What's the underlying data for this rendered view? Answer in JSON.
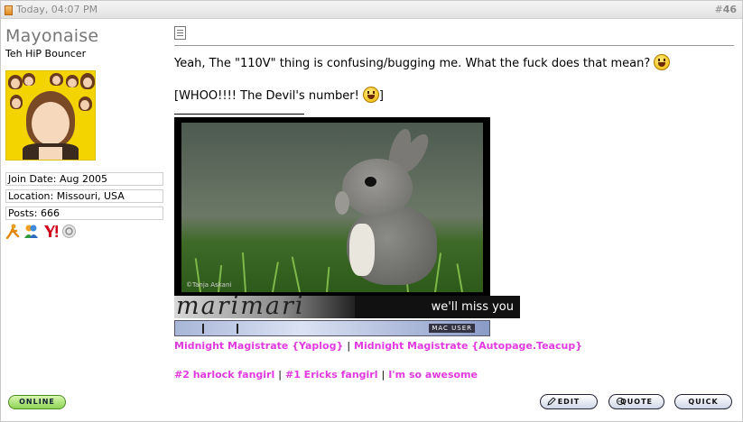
{
  "header": {
    "date": "Today, 04:07 PM",
    "post_hash": "#",
    "post_number": "46"
  },
  "user": {
    "name": "Mayonaise",
    "title": "Teh HiP Bouncer",
    "join_date": "Join Date: Aug 2005",
    "location": "Location: Missouri, USA",
    "posts": "Posts: 666",
    "im_icons": [
      "aim-icon",
      "msn-icon",
      "yahoo-icon",
      "skype-icon"
    ]
  },
  "message": {
    "line1": "Yeah, The \"110V\" thing is confusing/bugging me. What the fuck does that mean?",
    "line2_open": "[WHOO!!!! The Devil's number!",
    "line2_close": "]"
  },
  "signature": {
    "photo_credit": "©Tanja Askani",
    "script_text": "marimari",
    "miss_text": "we'll miss you",
    "mac_label": "MAC USER",
    "links": [
      "Midnight Magistrate {Yaplog}",
      "Midnight Magistrate {Autopage.Teacup}"
    ],
    "links2": [
      "#2 harlock fangirl",
      "#1 Ericks fangirl",
      "I'm so awesome"
    ],
    "link_color": "#e03adf"
  },
  "buttons": {
    "online": "ONLINE",
    "edit": "EDIT",
    "quote": "QUOTE",
    "quick": "QUICK"
  }
}
